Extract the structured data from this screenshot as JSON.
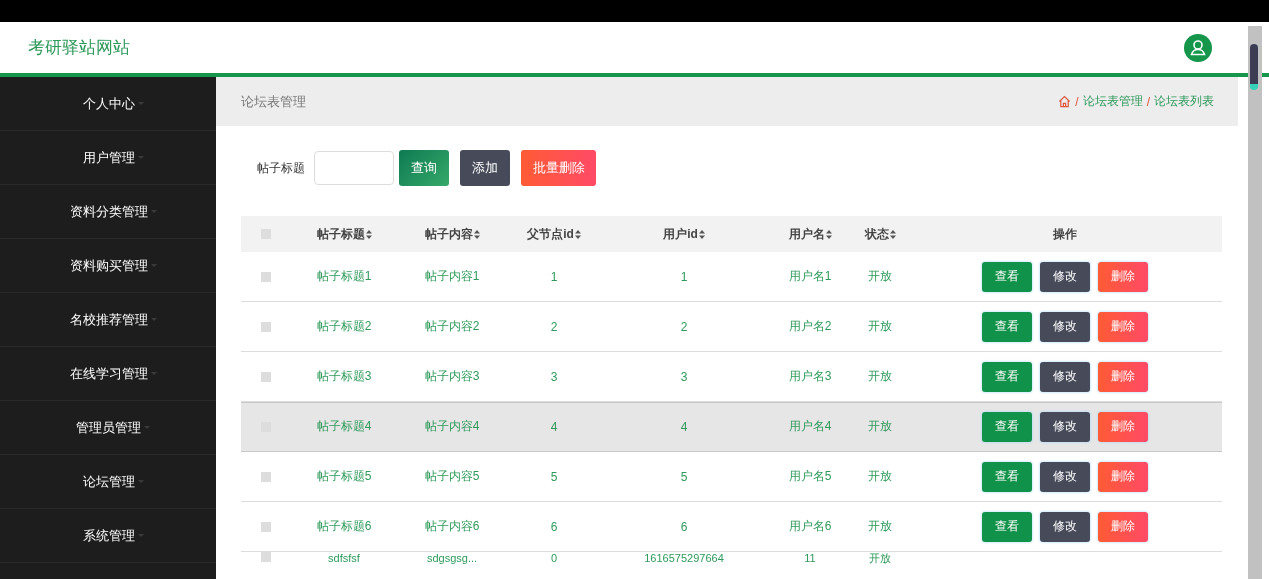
{
  "header": {
    "site_title": "考研驿站网站"
  },
  "sidebar": {
    "items": [
      {
        "label": "个人中心"
      },
      {
        "label": "用户管理"
      },
      {
        "label": "资料分类管理"
      },
      {
        "label": "资料购买管理"
      },
      {
        "label": "名校推荐管理"
      },
      {
        "label": "在线学习管理"
      },
      {
        "label": "管理员管理"
      },
      {
        "label": "论坛管理"
      },
      {
        "label": "系统管理"
      }
    ]
  },
  "page_title": "论坛表管理",
  "breadcrumb": [
    {
      "separator": "/",
      "label": "论坛表管理"
    },
    {
      "separator": "/",
      "label": "论坛表列表"
    }
  ],
  "search": {
    "label": "帖子标题",
    "buttons": [
      {
        "label": "查询",
        "kind": "query"
      },
      {
        "label": "添加",
        "kind": "add"
      },
      {
        "label": "批量删除",
        "kind": "batch-delete"
      }
    ]
  },
  "table": {
    "select_all": {
      "checked": false
    },
    "columns": [
      {
        "label": "帖子标题",
        "sortable": true
      },
      {
        "label": "帖子内容",
        "sortable": true
      },
      {
        "label": "父节点id",
        "sortable": true
      },
      {
        "label": "用户id",
        "sortable": true
      },
      {
        "label": "用户名",
        "sortable": true
      },
      {
        "label": "状态",
        "sortable": true
      },
      {
        "label": "操作",
        "sortable": false
      }
    ],
    "rows": [
      {
        "checked": false,
        "highlighted": false,
        "cells": [
          "帖子标题1",
          "帖子内容1",
          "1",
          "1",
          "用户名1",
          "开放"
        ],
        "actions": [
          {
            "label": "查看",
            "kind": "view"
          },
          {
            "label": "修改",
            "kind": "edit"
          },
          {
            "label": "删除",
            "kind": "delete"
          }
        ]
      },
      {
        "checked": false,
        "highlighted": false,
        "cells": [
          "帖子标题2",
          "帖子内容2",
          "2",
          "2",
          "用户名2",
          "开放"
        ],
        "actions": [
          {
            "label": "查看",
            "kind": "view"
          },
          {
            "label": "修改",
            "kind": "edit"
          },
          {
            "label": "删除",
            "kind": "delete"
          }
        ]
      },
      {
        "checked": false,
        "highlighted": false,
        "cells": [
          "帖子标题3",
          "帖子内容3",
          "3",
          "3",
          "用户名3",
          "开放"
        ],
        "actions": [
          {
            "label": "查看",
            "kind": "view"
          },
          {
            "label": "修改",
            "kind": "edit"
          },
          {
            "label": "删除",
            "kind": "delete"
          }
        ]
      },
      {
        "checked": false,
        "highlighted": true,
        "cells": [
          "帖子标题4",
          "帖子内容4",
          "4",
          "4",
          "用户名4",
          "开放"
        ],
        "actions": [
          {
            "label": "查看",
            "kind": "view"
          },
          {
            "label": "修改",
            "kind": "edit"
          },
          {
            "label": "删除",
            "kind": "delete"
          }
        ]
      },
      {
        "checked": false,
        "highlighted": false,
        "cells": [
          "帖子标题5",
          "帖子内容5",
          "5",
          "5",
          "用户名5",
          "开放"
        ],
        "actions": [
          {
            "label": "查看",
            "kind": "view"
          },
          {
            "label": "修改",
            "kind": "edit"
          },
          {
            "label": "删除",
            "kind": "delete"
          }
        ]
      },
      {
        "checked": false,
        "highlighted": false,
        "cells": [
          "帖子标题6",
          "帖子内容6",
          "6",
          "6",
          "用户名6",
          "开放"
        ],
        "actions": [
          {
            "label": "查看",
            "kind": "view"
          },
          {
            "label": "修改",
            "kind": "edit"
          },
          {
            "label": "删除",
            "kind": "delete"
          }
        ]
      },
      {
        "checked": false,
        "highlighted": false,
        "partial": true,
        "cells": [
          "sdfsfsf",
          "sdgsgsg...",
          "0",
          "1616575297664",
          "11",
          "开放"
        ]
      }
    ]
  }
}
